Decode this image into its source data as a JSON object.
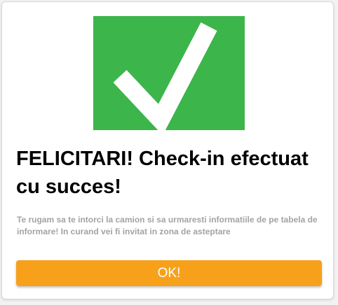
{
  "dialog": {
    "icon": "checkmark-icon",
    "title": "FELICITARI! Check-in efectuat cu succes!",
    "message": "Te rugam sa te intorci la camion si sa urmaresti informatiile de pe tabela de informare! In curand vei fi invitat in zona de asteptare",
    "ok_label": "OK!"
  },
  "colors": {
    "success_green": "#3cb54a",
    "button_orange": "#f7a11b",
    "message_gray": "#a3a3a3"
  }
}
